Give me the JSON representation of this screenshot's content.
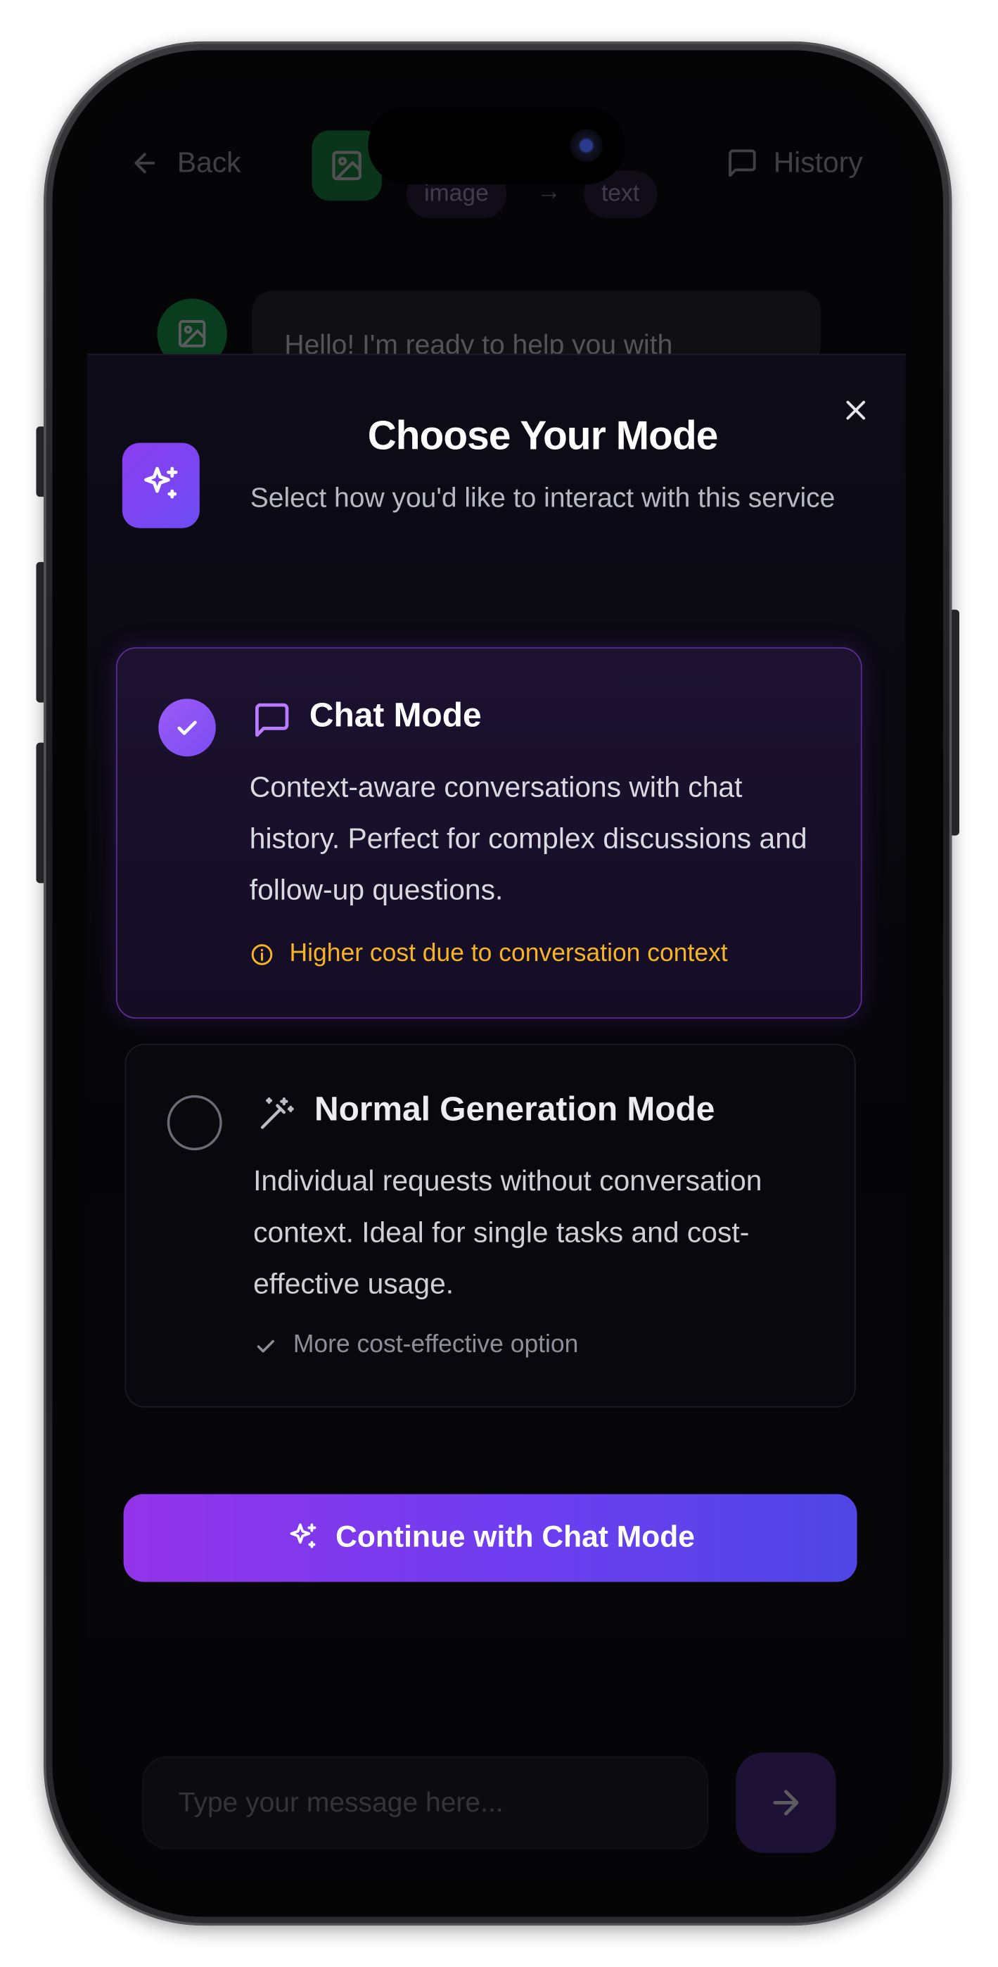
{
  "header": {
    "back_label": "Back",
    "history_label": "History",
    "chips": [
      "image",
      "text"
    ]
  },
  "chat": {
    "greeting": "Hello! I'm ready to help you with"
  },
  "composer": {
    "placeholder": "Type your message here..."
  },
  "modal": {
    "title": "Choose Your Mode",
    "subtitle": "Select how you'd like to interact with this service",
    "modes": [
      {
        "title": "Chat Mode",
        "description": "Context-aware conversations with chat history. Perfect for complex discussions and follow-up questions.",
        "note": "Higher cost due to conversation context",
        "selected": true
      },
      {
        "title": "Normal Generation Mode",
        "description": "Individual requests without conversation context. Ideal for single tasks and cost-effective usage.",
        "note": "More cost-effective option",
        "selected": false
      }
    ],
    "continue_label": "Continue with Chat Mode"
  },
  "colors": {
    "accent_start": "#9333ea",
    "accent_end": "#4f46e5",
    "warning": "#f5b325",
    "app_green": "#16a34a"
  },
  "icons": {
    "back": "arrow-left-icon",
    "app": "image-icon",
    "history": "message-square-icon",
    "close": "close-icon",
    "mode_badge": "sparkles-icon",
    "chat_mode": "message-square-icon",
    "normal_mode": "magic-wand-icon",
    "warning": "info-circle-icon",
    "ok": "check-icon",
    "send": "arrow-right-icon"
  }
}
